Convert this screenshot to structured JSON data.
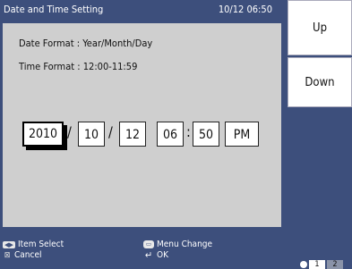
{
  "header": {
    "title": "Date and Time Setting",
    "datetime": "10/12 06:50"
  },
  "formats": {
    "date": "Date Format : Year/Month/Day",
    "time": "Time Format : 12:00-11:59"
  },
  "fields": {
    "year": "2010",
    "month": "10",
    "day": "12",
    "hour": "06",
    "minute": "50",
    "ampm": "PM",
    "date_sep": "/",
    "time_sep": ":"
  },
  "side_buttons": {
    "up": "Up",
    "down": "Down"
  },
  "footer": {
    "item_select": "Item Select",
    "menu_change": "Menu Change",
    "cancel": "Cancel",
    "ok": "OK"
  },
  "pager": {
    "pages": [
      "1",
      "2"
    ],
    "active": "1"
  }
}
